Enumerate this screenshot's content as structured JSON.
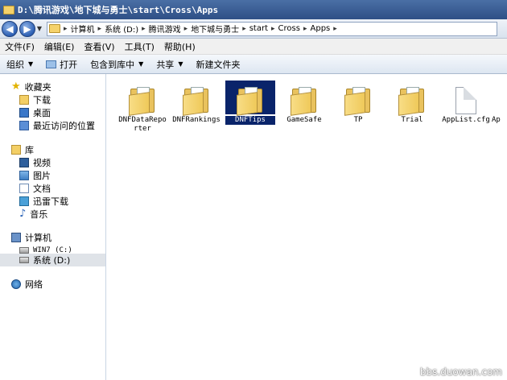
{
  "window": {
    "title": "D:\\腾讯游戏\\地下城与勇士\\start\\Cross\\Apps"
  },
  "address": {
    "back_glyph": "◀",
    "forward_glyph": "▶",
    "crumbs": [
      "计算机",
      "系统 (D:)",
      "腾讯游戏",
      "地下城与勇士",
      "start",
      "Cross",
      "Apps"
    ]
  },
  "menu": {
    "items": [
      "文件(F)",
      "编辑(E)",
      "查看(V)",
      "工具(T)",
      "帮助(H)"
    ]
  },
  "toolbar": {
    "organize": "组织",
    "open": "打开",
    "include": "包含到库中",
    "share": "共享",
    "new_folder": "新建文件夹"
  },
  "nav": {
    "favorites": "收藏夹",
    "downloads": "下载",
    "desktop": "桌面",
    "recent": "最近访问的位置",
    "libraries": "库",
    "videos": "视频",
    "pictures": "图片",
    "documents": "文档",
    "thunder": "迅雷下载",
    "music": "音乐",
    "computer": "计算机",
    "drive_c": "WIN7 (C:)",
    "drive_d": "系统 (D:)",
    "network": "网络"
  },
  "files": [
    {
      "name": "DNFDataReporter",
      "kind": "folder"
    },
    {
      "name": "DNFRankings",
      "kind": "folder"
    },
    {
      "name": "DNFTips",
      "kind": "folder",
      "selected": true
    },
    {
      "name": "GameSafe",
      "kind": "folder"
    },
    {
      "name": "TP",
      "kind": "folder"
    },
    {
      "name": "Trial",
      "kind": "folder"
    },
    {
      "name": "AppList.cfg",
      "kind": "file"
    },
    {
      "name": "Ap",
      "kind": "file"
    }
  ],
  "watermark": "bbs.duowan.com"
}
